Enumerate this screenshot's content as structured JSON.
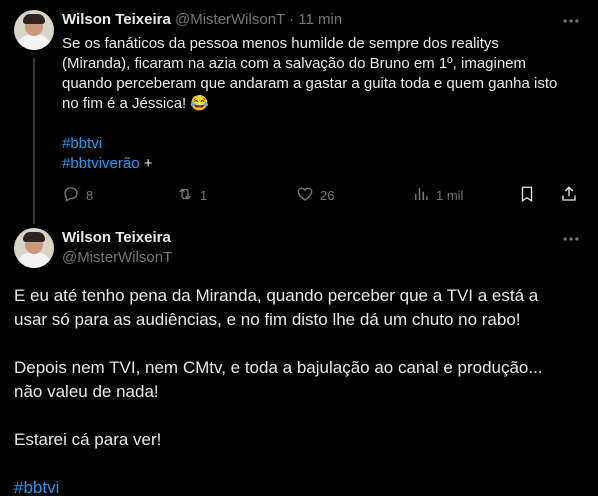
{
  "tweet1": {
    "name": "Wilson Teixeira",
    "handle": "@MisterWilsonT",
    "separator": "·",
    "time": "11 min",
    "text_lines": [
      "Se os fanáticos da pessoa menos humilde de sempre dos realitys",
      "(Miranda), ficaram na azia com a salvação do Bruno em 1º, imaginem",
      "quando perceberam que andaram a gastar a guita toda e quem ganha isto",
      "no fim é a Jéssica! 😂"
    ],
    "hashtag1": "#bbtvi",
    "hashtag2": "#bbtviverão",
    "hashtag2_suffix": " +",
    "actions": {
      "replies": "8",
      "retweets": "1",
      "likes": "26",
      "views": "1 mil"
    }
  },
  "tweet2": {
    "name": "Wilson Teixeira",
    "handle": "@MisterWilsonT",
    "paragraph1_line1": "E eu até tenho pena da Miranda, quando perceber que a TVI a está a",
    "paragraph1_line2": "usar só para as audiências, e no fim disto lhe dá um chuto no rabo!",
    "paragraph2_line1": "Depois nem TVI, nem CMtv, e toda a bajulação ao canal e produção...",
    "paragraph2_line2": "não valeu de nada!",
    "paragraph3": "Estarei cá para ver!",
    "hashtag": "#bbtvi"
  },
  "icons": {
    "more": "more-horizontal-icon",
    "reply": "reply-icon",
    "retweet": "retweet-icon",
    "like": "heart-icon",
    "views": "analytics-icon",
    "bookmark": "bookmark-icon",
    "share": "share-icon"
  },
  "colors": {
    "background": "#000000",
    "text": "#e7e9ea",
    "muted": "#71767b",
    "link": "#1d9bf0",
    "thread_line": "#333639"
  }
}
